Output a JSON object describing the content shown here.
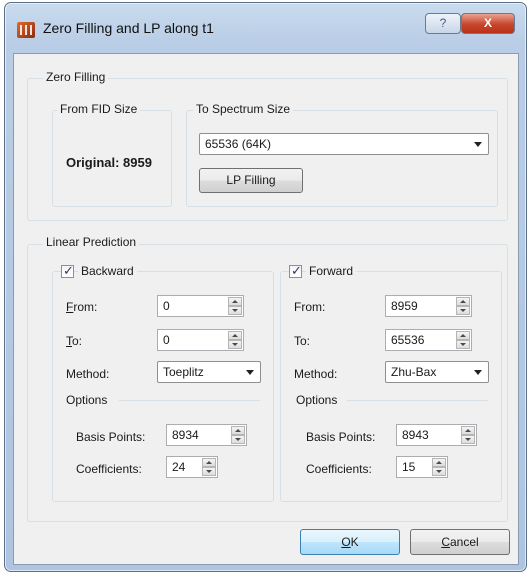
{
  "window": {
    "title": "Zero Filling and LP along t1",
    "help_label": "?",
    "close_label": "X"
  },
  "zero_filling": {
    "group_title": "Zero Filling",
    "from_label": "From FID Size",
    "original_text": "Original: 8959",
    "to_label": "To Spectrum Size",
    "spectrum_size_value": "65536 (64K)",
    "lp_filling_button": "LP Filling"
  },
  "linear_prediction": {
    "group_title": "Linear Prediction",
    "backward": {
      "checkbox_label": "Backward",
      "checked": true,
      "from_label": "From:",
      "from_value": "0",
      "to_label": "To:",
      "to_value": "0",
      "method_label": "Method:",
      "method_value": "Toeplitz",
      "options_label": "Options",
      "basis_points_label": "Basis Points:",
      "basis_points_value": "8934",
      "coefficients_label": "Coefficients:",
      "coefficients_value": "24"
    },
    "forward": {
      "checkbox_label": "Forward",
      "checked": true,
      "from_label": "From:",
      "from_value": "8959",
      "to_label": "To:",
      "to_value": "65536",
      "method_label": "Method:",
      "method_value": "Zhu-Bax",
      "options_label": "Options",
      "basis_points_label": "Basis Points:",
      "basis_points_value": "8943",
      "coefficients_label": "Coefficients:",
      "coefficients_value": "15"
    }
  },
  "buttons": {
    "ok_label": "OK",
    "cancel_label": "Cancel"
  },
  "icons": {
    "app": "app-icon",
    "checkmark": "✓"
  }
}
